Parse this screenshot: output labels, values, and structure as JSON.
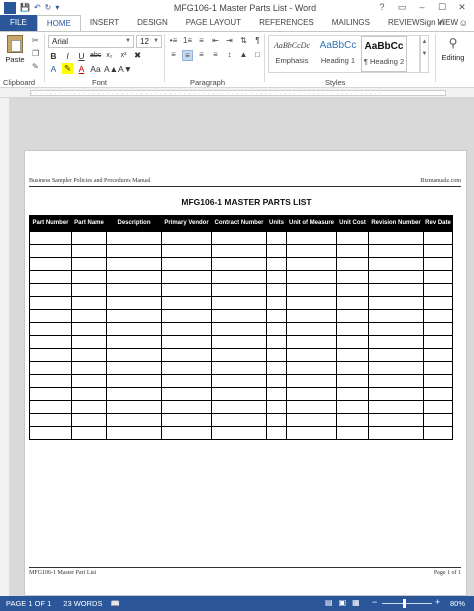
{
  "window": {
    "title": "MFG106-1 Master Parts List - Word",
    "controls": [
      "?",
      "▭",
      "–",
      "☐",
      "✕"
    ]
  },
  "qat": {
    "app_icon": "W"
  },
  "tabs": [
    {
      "label": "FILE"
    },
    {
      "label": "HOME"
    },
    {
      "label": "INSERT"
    },
    {
      "label": "DESIGN"
    },
    {
      "label": "PAGE LAYOUT"
    },
    {
      "label": "REFERENCES"
    },
    {
      "label": "MAILINGS"
    },
    {
      "label": "REVIEW"
    },
    {
      "label": "VIEW"
    }
  ],
  "account": {
    "signin": "Sign in"
  },
  "ribbon": {
    "clipboard": {
      "paste_label": "Paste",
      "group_label": "Clipboard"
    },
    "font": {
      "name": "Arial",
      "size": "12",
      "group_label": "Font"
    },
    "paragraph": {
      "group_label": "Paragraph"
    },
    "styles": {
      "group_label": "Styles",
      "items": [
        {
          "sample": "AaBbCcDc",
          "name": "Emphasis"
        },
        {
          "sample": "AaBbCc",
          "name": "Heading 1"
        },
        {
          "sample": "AaBbCc",
          "name": "¶ Heading 2"
        }
      ]
    },
    "editing": {
      "label": "Editing"
    }
  },
  "document": {
    "header_left": "Business Sampler Policies and Procedures Manual",
    "header_right": "Bizmanualz.com",
    "title": "MFG106-1   MASTER PARTS LIST",
    "columns": [
      "Part Number",
      "Part Name",
      "Description",
      "Primary Vendor",
      "Contract Number",
      "Units",
      "Unit of Measure",
      "Unit Cost",
      "Revision Number",
      "Rev Date"
    ],
    "footer_left": "MFG106-1 Master Part List",
    "footer_right": "Page 1 of 1"
  },
  "status": {
    "page": "PAGE 1 OF 1",
    "words": "23 WORDS",
    "zoom_minus": "−",
    "zoom_plus": "+",
    "zoom": "80%",
    "zoom_level_percent": 80
  }
}
